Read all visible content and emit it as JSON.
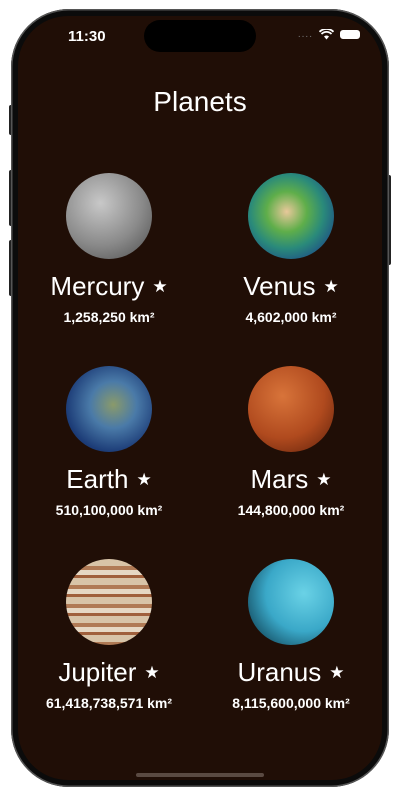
{
  "status_bar": {
    "time": "11:30",
    "signal": "....",
    "wifi_icon": "wifi-icon",
    "battery_icon": "battery-icon"
  },
  "header": {
    "title": "Planets"
  },
  "colors": {
    "background": "#200e06",
    "text": "#ffffff"
  },
  "planets": [
    {
      "name": "Mercury",
      "area": "1,258,250 km²",
      "favorite_icon": "star-icon"
    },
    {
      "name": "Venus",
      "area": "4,602,000 km²",
      "favorite_icon": "star-icon"
    },
    {
      "name": "Earth",
      "area": "510,100,000 km²",
      "favorite_icon": "star-icon"
    },
    {
      "name": "Mars",
      "area": "144,800,000 km²",
      "favorite_icon": "star-icon"
    },
    {
      "name": "Jupiter",
      "area": "61,418,738,571 km²",
      "favorite_icon": "star-icon"
    },
    {
      "name": "Uranus",
      "area": "8,115,600,000 km²",
      "favorite_icon": "star-icon"
    }
  ]
}
